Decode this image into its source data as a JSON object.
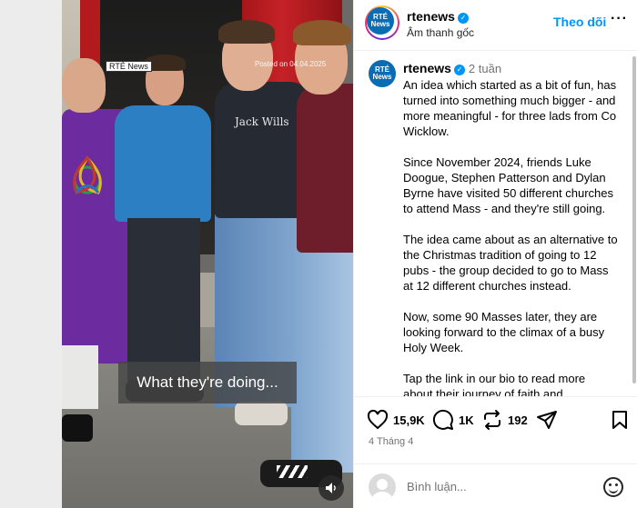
{
  "video": {
    "badge_text": "RTÉ News",
    "posted_label": "Posted on 04.04.2025",
    "caption": "What they're doing...",
    "shirt_text": "Jack Wills"
  },
  "header": {
    "avatar_text": "RTÉ News",
    "username": "rtenews",
    "audio": "Âm thanh gốc",
    "follow_label": "Theo dõi",
    "more_label": "···"
  },
  "post": {
    "avatar_text": "RTÉ News",
    "username": "rtenews",
    "time": "2 tuần",
    "paragraphs": [
      "An idea which started as a bit of fun, has turned into something much bigger - and more meaningful - for three lads from Co Wicklow.",
      "Since November 2024, friends Luke Doogue, Stephen Patterson and Dylan Byrne have visited 50 different churches to attend Mass - and they're still going.",
      "The idea came about as an alternative to the Christmas tradition of going to 12 pubs - the group decided to go to Mass at 12 different churches instead.",
      "Now, some 90 Masses later, they are looking forward to the climax of a busy Holy Week.",
      "Tap the link in our bio to read more about their journey of faith and"
    ]
  },
  "actions": {
    "likes": "15,9K",
    "comments": "1K",
    "reposts": "192",
    "date": "4 Tháng 4"
  },
  "comment_box": {
    "placeholder": "Bình luận..."
  },
  "colors": {
    "accent": "#0095f6",
    "brand": "#0a6cb3"
  }
}
